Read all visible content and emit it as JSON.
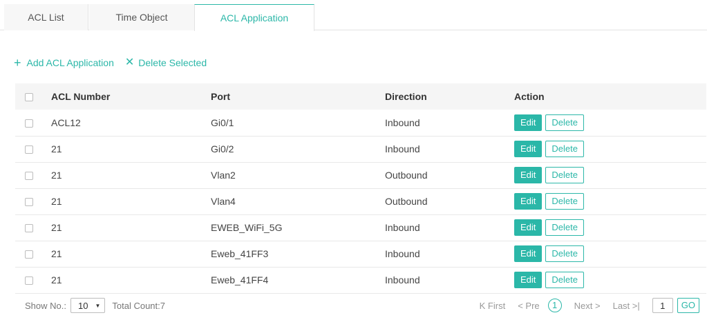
{
  "tabs": [
    {
      "label": "ACL List"
    },
    {
      "label": "Time Object"
    },
    {
      "label": "ACL Application"
    }
  ],
  "actions": {
    "add_label": "Add ACL Application",
    "delete_label": "Delete Selected"
  },
  "table": {
    "headers": [
      "ACL Number",
      "Port",
      "Direction",
      "Action"
    ],
    "rows": [
      {
        "acl": "ACL12",
        "port": "Gi0/1",
        "direction": "Inbound"
      },
      {
        "acl": "21",
        "port": "Gi0/2",
        "direction": "Inbound"
      },
      {
        "acl": "21",
        "port": "Vlan2",
        "direction": "Outbound"
      },
      {
        "acl": "21",
        "port": "Vlan4",
        "direction": "Outbound"
      },
      {
        "acl": "21",
        "port": "EWEB_WiFi_5G",
        "direction": "Inbound"
      },
      {
        "acl": "21",
        "port": "Eweb_41FF3",
        "direction": "Inbound"
      },
      {
        "acl": "21",
        "port": "Eweb_41FF4",
        "direction": "Inbound"
      }
    ],
    "edit_label": "Edit",
    "delete_label": "Delete"
  },
  "pager": {
    "show_label": "Show No.:",
    "page_size": "10",
    "total_label": "Total Count:7",
    "first": "First",
    "prev": "Pre",
    "current": "1",
    "next": "Next",
    "last": "Last",
    "page_input": "1",
    "go": "GO"
  },
  "colors": {
    "accent": "#2bb7a8",
    "header_bg": "#f5f5f5"
  },
  "icons": {
    "add": "plus-icon",
    "delete": "close-icon"
  }
}
